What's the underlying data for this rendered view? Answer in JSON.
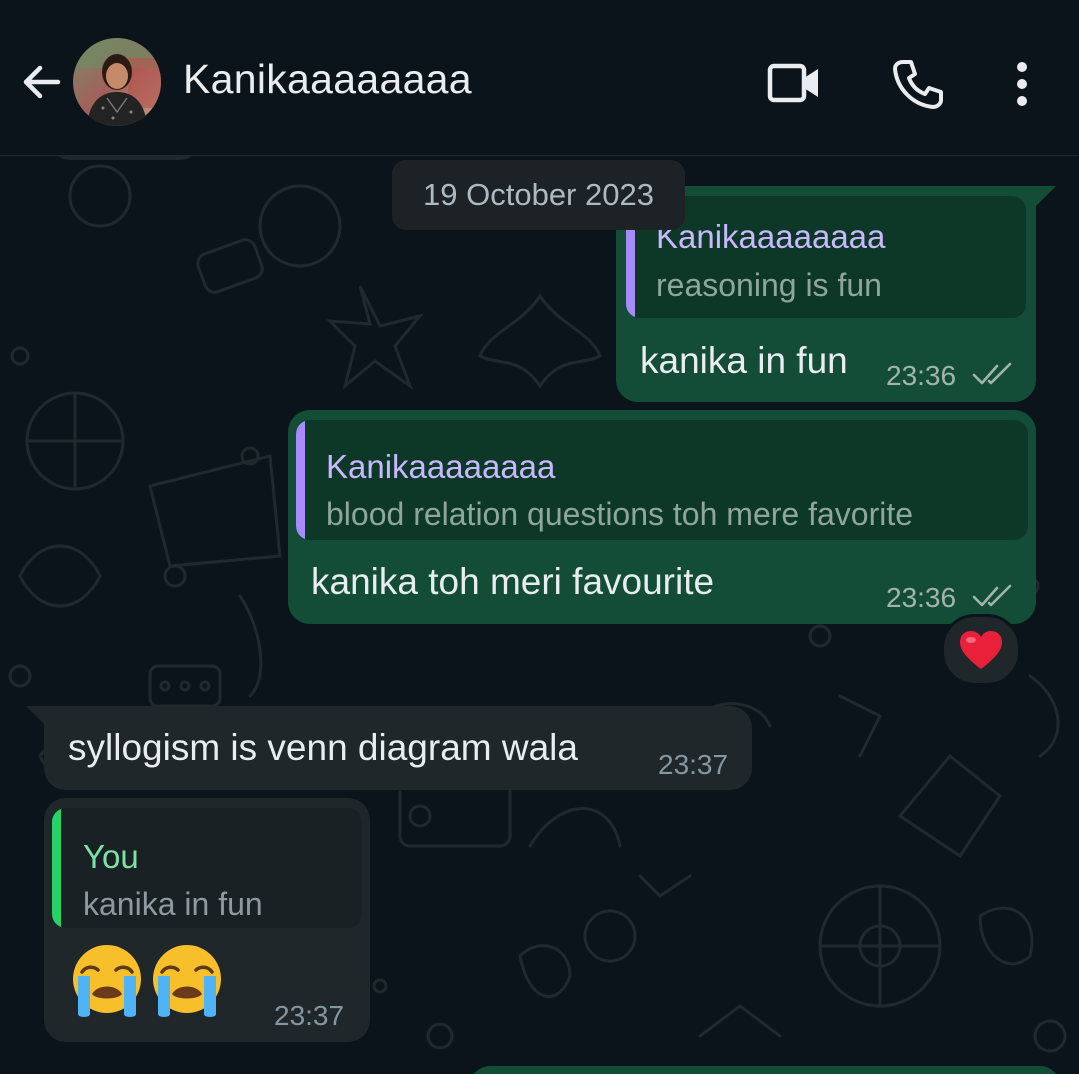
{
  "header": {
    "contact_name": "Kanikaaaaaaaa"
  },
  "chat": {
    "date_chip": "19 October 2023",
    "messages": [
      {
        "direction": "outgoing",
        "quote_name": "Kanikaaaaaaaa",
        "quote_text": "reasoning is fun",
        "text": "kanika in fun",
        "time": "23:36"
      },
      {
        "direction": "outgoing",
        "quote_name": "Kanikaaaaaaaa",
        "quote_text": "blood relation questions toh mere favorite",
        "text": "kanika toh meri favourite",
        "time": "23:36",
        "reaction": "❤️"
      },
      {
        "direction": "incoming",
        "text": "syllogism is venn diagram wala",
        "time": "23:37"
      },
      {
        "direction": "incoming",
        "quote_name": "You",
        "quote_text": "kanika in fun",
        "text": "😭😭",
        "time": "23:37"
      }
    ]
  },
  "colors": {
    "header_bg": "#0b141a",
    "outgoing_bubble": "#134d37",
    "incoming_bubble": "#1f272a",
    "quote_bar_contact": "#a78bfa",
    "quote_name_contact": "#c7b8ff",
    "quote_bar_you": "#25d366",
    "quote_name_you": "#7ee2a8"
  },
  "icons": [
    "back-arrow-icon",
    "video-call-icon",
    "phone-icon",
    "more-vert-icon",
    "double-check-icon",
    "heart-icon",
    "loudly-crying-face-icon"
  ]
}
